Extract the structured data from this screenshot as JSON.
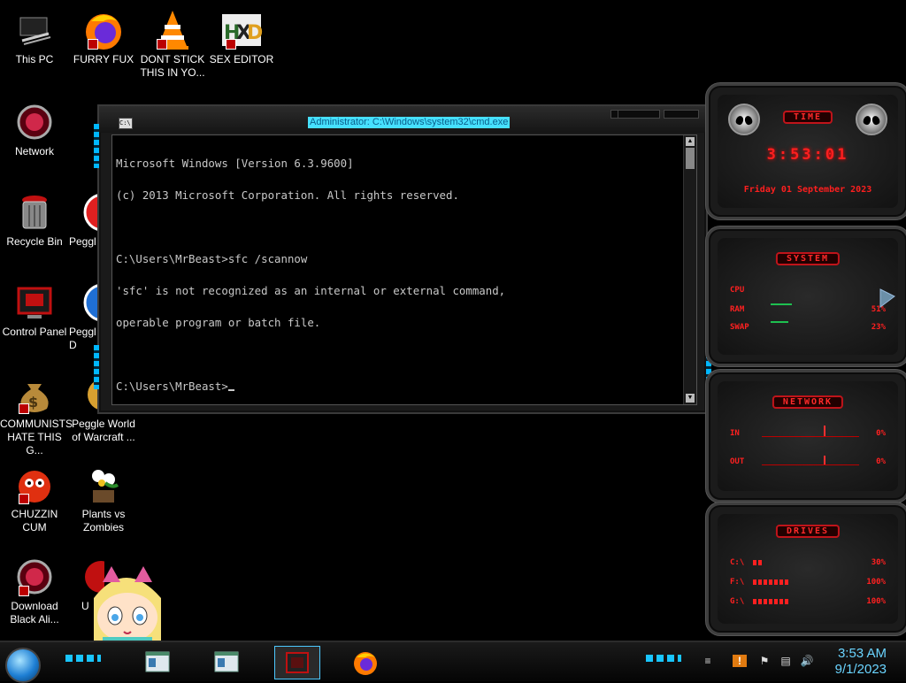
{
  "desktop_icons": [
    {
      "id": "this-pc",
      "label": "This PC"
    },
    {
      "id": "furry-fux",
      "label": "FURRY FUX"
    },
    {
      "id": "dont-stick",
      "label": "DONT STICK THIS IN YO..."
    },
    {
      "id": "sex-editor",
      "label": "SEX EDITOR"
    },
    {
      "id": "network",
      "label": "Network"
    },
    {
      "id": "recycle-bin",
      "label": "Recycle Bin"
    },
    {
      "id": "peggle-1",
      "label": "Peggl"
    },
    {
      "id": "control-panel",
      "label": "Control Panel"
    },
    {
      "id": "peggle-2",
      "label": "Peggl D"
    },
    {
      "id": "communists",
      "label": "COMMUNISTS HATE THIS G..."
    },
    {
      "id": "peggle-wow",
      "label": "Peggle World of Warcraft ..."
    },
    {
      "id": "chuzzin",
      "label": "CHUZZIN CUM"
    },
    {
      "id": "pvz",
      "label": "Plants vs Zombies"
    },
    {
      "id": "download-alienware",
      "label": "Download Black Ali..."
    },
    {
      "id": "partial",
      "label": "U"
    }
  ],
  "cmd": {
    "title": "Administrator: C:\\Windows\\system32\\cmd.exe",
    "icon_text": "C:\\",
    "lines": [
      "Microsoft Windows [Version 6.3.9600]",
      "(c) 2013 Microsoft Corporation. All rights reserved.",
      "",
      "C:\\Users\\MrBeast>sfc /scannow",
      "'sfc' is not recognized as an internal or external command,",
      "operable program or batch file.",
      "",
      "C:\\Users\\MrBeast>"
    ]
  },
  "gadgets": {
    "time": {
      "header": "TIME",
      "clock": "3:53:01",
      "date": "Friday 01 September 2023"
    },
    "system": {
      "header": "SYSTEM",
      "rows": [
        {
          "label": "CPU",
          "value": "",
          "level": 0.0
        },
        {
          "label": "RAM",
          "value": "51%",
          "level": 0.51
        },
        {
          "label": "SWAP",
          "value": "23%",
          "level": 0.23
        }
      ]
    },
    "network": {
      "header": "NETWORK",
      "rows": [
        {
          "label": "IN",
          "value": "0%"
        },
        {
          "label": "OUT",
          "value": "0%"
        }
      ]
    },
    "drives": {
      "header": "DRIVES",
      "rows": [
        {
          "label": "C:\\",
          "value": "30%",
          "level": 0.3
        },
        {
          "label": "F:\\",
          "value": "100%",
          "level": 1.0
        },
        {
          "label": "G:\\",
          "value": "100%",
          "level": 1.0
        }
      ]
    }
  },
  "taskbar": {
    "buttons": [
      {
        "id": "tb-app1",
        "icon": "window-icon"
      },
      {
        "id": "tb-app2",
        "icon": "window-icon"
      },
      {
        "id": "tb-cmd",
        "icon": "cmd-icon",
        "active": true
      },
      {
        "id": "tb-firefox",
        "icon": "firefox-icon"
      }
    ],
    "clock": {
      "time": "3:53 AM",
      "date": "9/1/2023"
    }
  },
  "colors": {
    "accent": "#19c5ff",
    "gadget_red": "#ff2020",
    "cmd_text": "#c8c8c8",
    "title_highlight": "#46e0ff"
  }
}
